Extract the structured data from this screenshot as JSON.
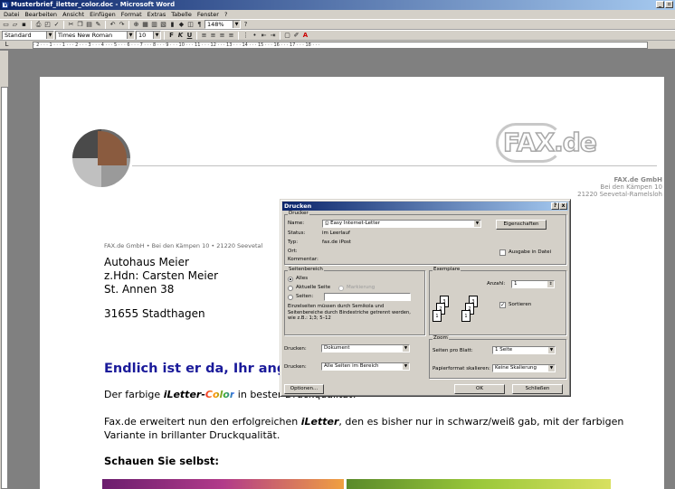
{
  "window": {
    "title": "Musterbrief_iletter_color.doc - Microsoft Word"
  },
  "menu": [
    "Datei",
    "Bearbeiten",
    "Ansicht",
    "Einfügen",
    "Format",
    "Extras",
    "Tabelle",
    "Fenster",
    "?"
  ],
  "toolbar": {
    "zoom": "148%",
    "style": "Standard",
    "font": "Times New Roman",
    "size": "10"
  },
  "letter": {
    "company_name": "FAX.de GmbH",
    "company_addr1": "Bei den Kämpen 10",
    "company_addr2": "21220 Seevetal-Ramelsloh",
    "sender_line": "FAX.de GmbH • Bei den Kämpen 10 • 21220 Seevetal",
    "recipient": [
      "Autohaus Meier",
      "z.Hdn: Carsten Meier",
      "St. Annen 38"
    ],
    "city": "31655 Stadthagen",
    "headline": "Endlich ist er da, Ihr ang",
    "p1_pre": "Der farbige ",
    "p1_brand": "iLetter-",
    "p1_color": "Color",
    "p1_post": " in bester Druckqualität!",
    "p2_pre": "Fax.de erweitert nun den erfolgreichen ",
    "p2_brand": "iLetter",
    "p2_post": ", den es bisher nur in schwarz/weiß gab, mit der farbigen Variante in brillanter Druckqualität.",
    "p3": "Schauen Sie selbst:"
  },
  "logo": {
    "text": "FAX.de"
  },
  "dialog": {
    "title": "Drucken",
    "help": "?",
    "close": "x",
    "printer_group": "Drucker",
    "name_label": "Name:",
    "name_value": "Easy Internet-Letter",
    "properties": "Eigenschaften",
    "status_label": "Status:",
    "status_value": "im Leerlauf",
    "type_label": "Typ:",
    "type_value": "fax.de iPost",
    "location_label": "Ort:",
    "comment_label": "Kommentar:",
    "print_to_file": "Ausgabe in Datei",
    "range_group": "Seitenbereich",
    "all": "Alles",
    "current": "Aktuelle Seite",
    "selection": "Markierung",
    "pages": "Seiten:",
    "range_hint": "Einzelseiten müssen durch Semikola und Seitenbereiche durch Bindestriche getrennt werden, wie z.B.: 1;3; 5–12",
    "copies_group": "Exemplare",
    "copies_label": "Anzahl:",
    "copies_value": "1",
    "collate": "Sortieren",
    "print_what_label": "Drucken:",
    "print_what_value": "Dokument",
    "print_label": "Drucken:",
    "print_value": "Alle Seiten im Bereich",
    "zoom_group": "Zoom",
    "pages_per_sheet_label": "Seiten pro Blatt:",
    "pages_per_sheet_value": "1 Seite",
    "scale_label": "Papierformat skalieren:",
    "scale_value": "Keine Skalierung",
    "options": "Optionen...",
    "ok": "OK",
    "cancel": "Schließen"
  }
}
